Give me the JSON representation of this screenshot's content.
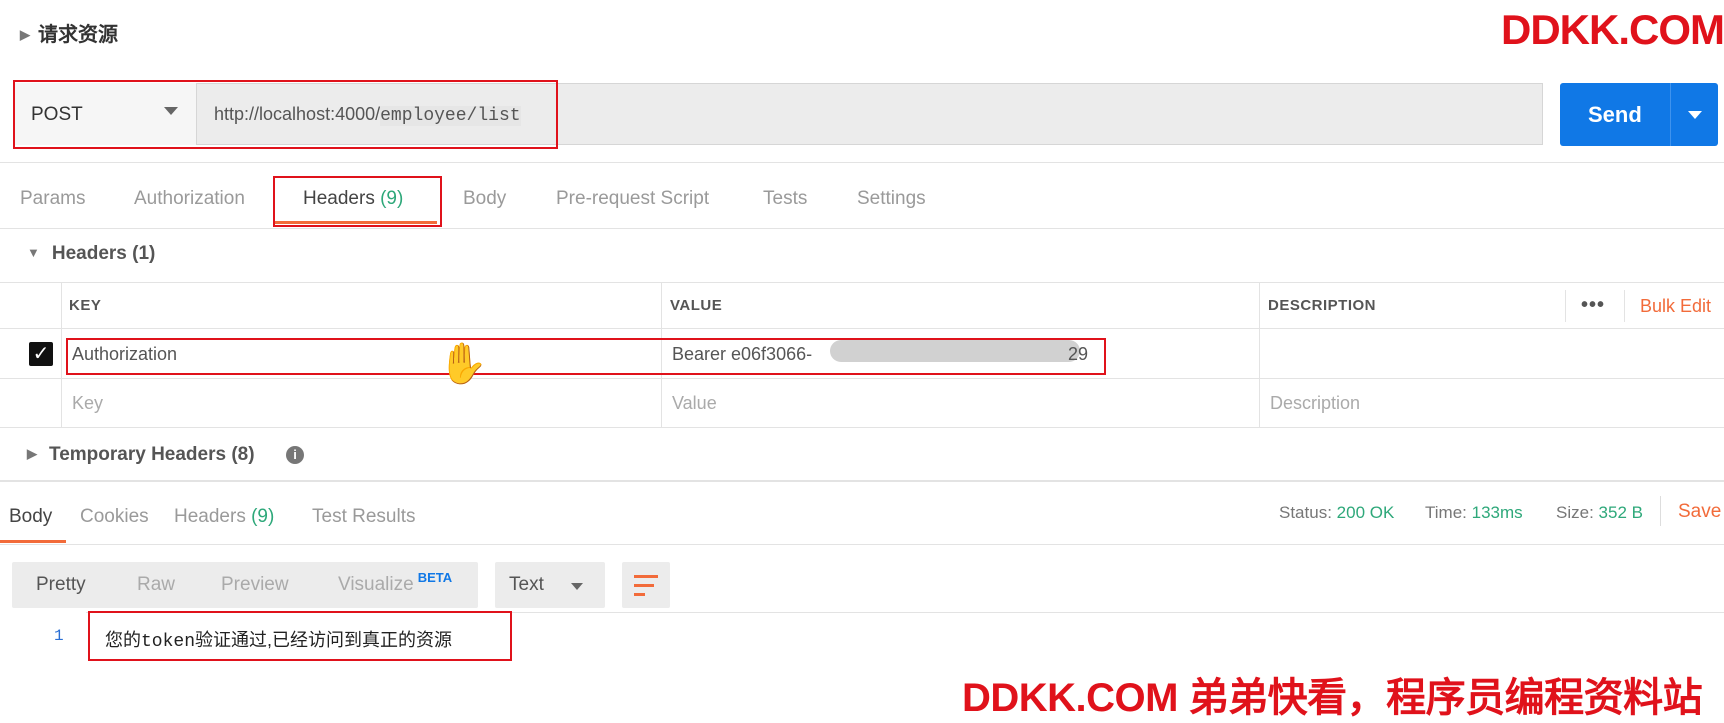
{
  "section": {
    "title": "请求资源"
  },
  "watermark_top": "DDKK.COM",
  "watermark_bottom": "DDKK.COM 弟弟快看，程序员编程资料站",
  "request": {
    "method": "POST",
    "url_prefix": "http://localhost:4000/",
    "url_path": "employee/list",
    "send_label": "Send"
  },
  "request_tabs": [
    {
      "label": "Params"
    },
    {
      "label": "Authorization"
    },
    {
      "label": "Headers",
      "count": "(9)"
    },
    {
      "label": "Body"
    },
    {
      "label": "Pre-request Script"
    },
    {
      "label": "Tests"
    },
    {
      "label": "Settings"
    }
  ],
  "headers_section": {
    "toggle": "Headers (1)",
    "columns": {
      "key": "KEY",
      "value": "VALUE",
      "description": "DESCRIPTION"
    },
    "more": "•••",
    "bulk_edit": "Bulk Edit",
    "row": {
      "key": "Authorization",
      "value": "Bearer e06f3066-",
      "value_tail": "29"
    },
    "placeholders": {
      "key": "Key",
      "value": "Value",
      "description": "Description"
    },
    "temporary": "Temporary Headers (8)"
  },
  "response_tabs": [
    {
      "label": "Body"
    },
    {
      "label": "Cookies"
    },
    {
      "label": "Headers",
      "count": "(9)"
    },
    {
      "label": "Test Results"
    }
  ],
  "status": {
    "status_label": "Status:",
    "status_value": "200 OK",
    "time_label": "Time:",
    "time_value": "133ms",
    "size_label": "Size:",
    "size_value": "352 B",
    "save": "Save"
  },
  "view_modes": [
    "Pretty",
    "Raw",
    "Preview",
    "Visualize"
  ],
  "beta": "BETA",
  "format": "Text",
  "body_line": {
    "number": "1",
    "text_before": "您的",
    "text_mono": "token",
    "text_after": "验证通过,已经访问到真正的资源"
  },
  "colors": {
    "accent": "#f26b3a",
    "send": "#1078e6",
    "status_green": "#2ea87a",
    "highlight_red": "#e0121b"
  }
}
